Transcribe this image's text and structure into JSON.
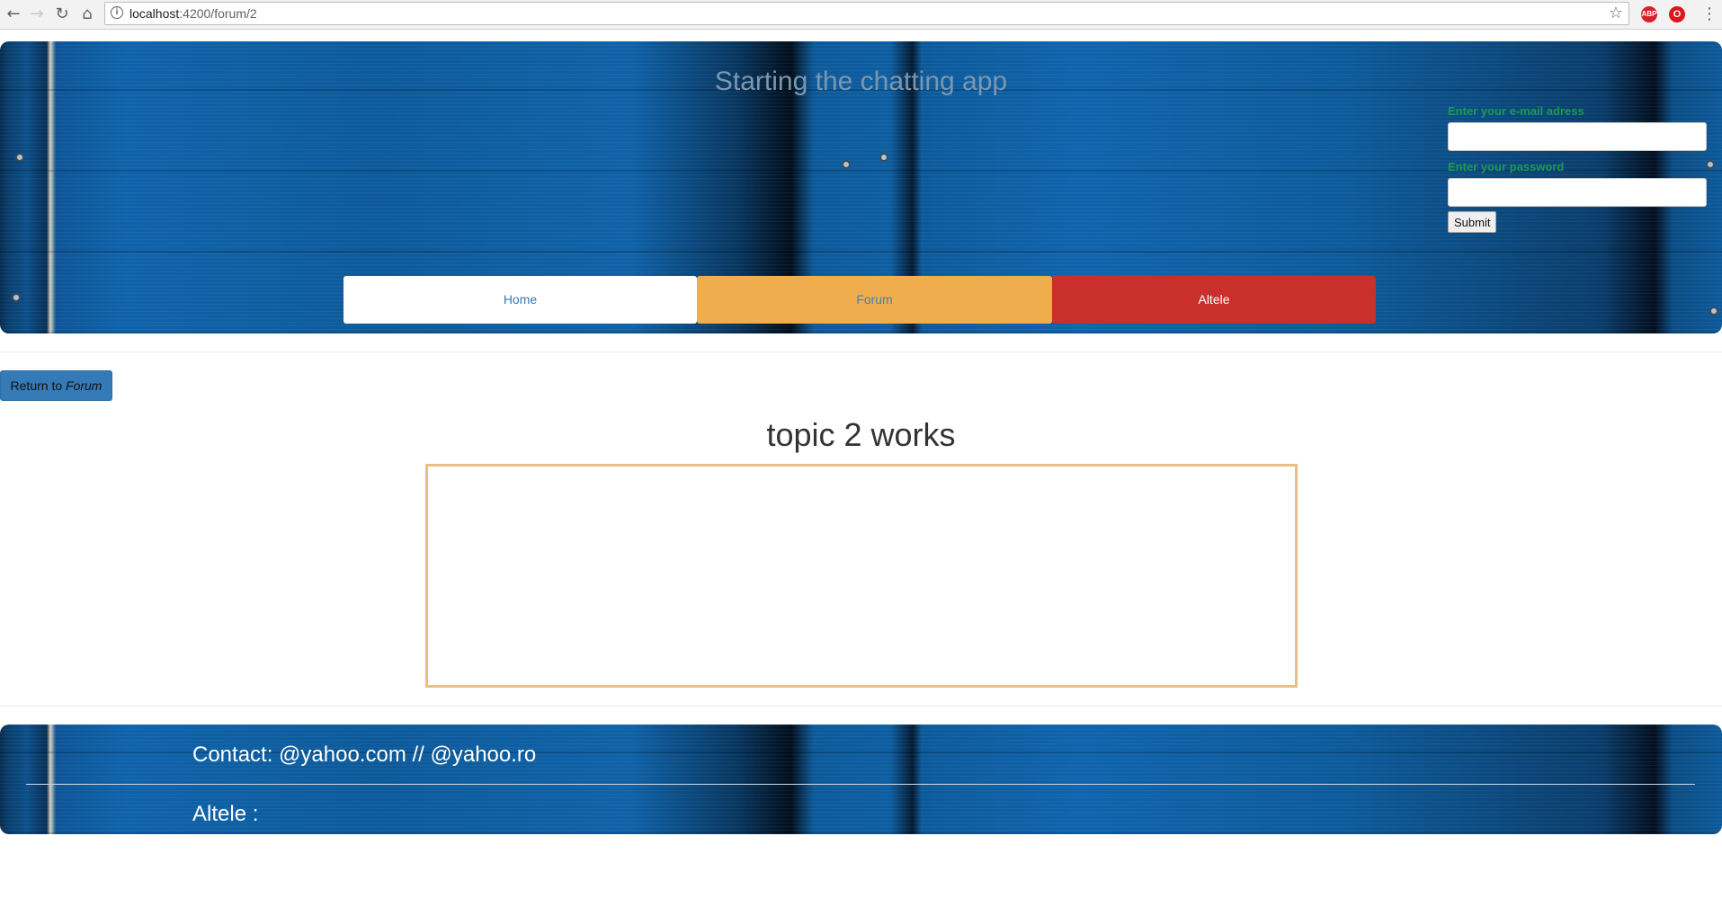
{
  "browser": {
    "url_host": "localhost",
    "url_path": ":4200/forum/2",
    "back_icon": "arrow-left",
    "forward_icon": "arrow-right",
    "reload_icon": "reload",
    "home_icon": "home",
    "bookmark_icon": "star",
    "extensions": [
      {
        "name": "adblock-plus",
        "label": "ABP",
        "color": "#d9202b"
      },
      {
        "name": "opera",
        "label": "O",
        "color": "#e0141d"
      }
    ]
  },
  "header": {
    "title": "Starting the chatting app",
    "login": {
      "email_label": "Enter your e-mail adress",
      "email_value": "",
      "password_label": "Enter your password",
      "password_value": "",
      "submit_label": "Submit"
    },
    "nav": {
      "home": "Home",
      "forum": "Forum",
      "altele": "Altele"
    }
  },
  "main": {
    "return_label": "Return to ",
    "return_target": "Forum",
    "topic_title": "topic 2 works"
  },
  "footer": {
    "contact": "Contact: @yahoo.com // @yahoo.ro",
    "altele": "Altele :"
  },
  "colors": {
    "accent_blue": "#337ab7",
    "forum_orange": "#f0ad4e",
    "altele_red": "#c9302c",
    "label_green": "#1a9a52",
    "box_border": "#e8bf86"
  }
}
